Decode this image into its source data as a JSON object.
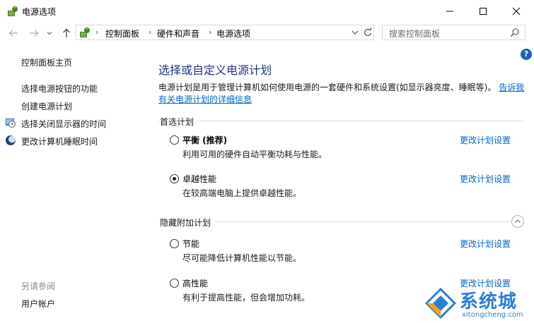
{
  "window": {
    "title": "电源选项"
  },
  "address": {
    "crumbs": [
      "控制面板",
      "硬件和声音",
      "电源选项"
    ],
    "search_placeholder": "搜索控制面板"
  },
  "help": {
    "glyph": "?"
  },
  "sidebar": {
    "home": "控制面板主页",
    "links": [
      "选择电源按钮的功能",
      "创建电源计划",
      "选择关闭显示器的时间",
      "更改计算机睡眠时间"
    ],
    "see_also_heading": "另请参阅",
    "see_also_links": [
      "用户帐户"
    ]
  },
  "main": {
    "title": "选择或自定义电源计划",
    "description_line1": "电源计划是用于管理计算机如何使用电源的一套硬件和系统设置(如显示器亮度、睡眠等)。",
    "description_link1": "告诉我",
    "description_link2": "有关电源计划的详细信息",
    "preferred_label": "首选计划",
    "hidden_label": "隐藏附加计划",
    "change_label": "更改计划设置",
    "plans": [
      {
        "name": "平衡 (推荐)",
        "desc": "利用可用的硬件自动平衡功耗与性能。",
        "selected": false
      },
      {
        "name": "卓越性能",
        "desc": "在较高端电脑上提供卓越性能。",
        "selected": true
      },
      {
        "name": "节能",
        "desc": "尽可能降低计算机性能以节能。",
        "selected": false
      },
      {
        "name": "高性能",
        "desc": "有利于提高性能，但会增加功耗。",
        "selected": false
      }
    ]
  },
  "watermark": {
    "name": "系统城",
    "url": "xitongcheng.com"
  }
}
